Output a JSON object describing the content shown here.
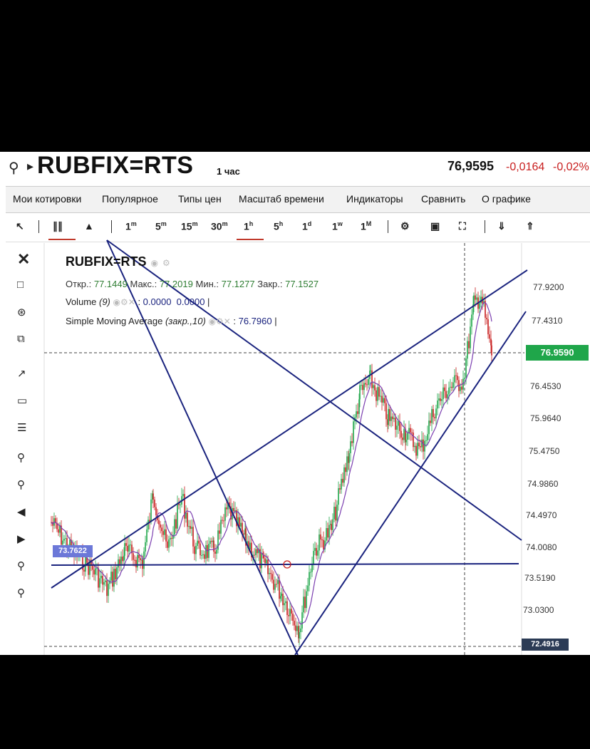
{
  "header": {
    "symbol": "RUBFIX=RTS",
    "interval": "1 час",
    "price": "76,9595",
    "change": "-0,0164",
    "change_pct": "-0,02%"
  },
  "menu": [
    "Мои котировки",
    "Популярное",
    "Типы цен",
    "Масштаб времени",
    "Индикаторы",
    "Сравнить",
    "О графике"
  ],
  "toolbar": {
    "timeframes": [
      "1m",
      "5m",
      "15m",
      "30m",
      "1h",
      "5h",
      "1d",
      "1w",
      "1M"
    ],
    "active_timeframe": "1h",
    "icons": [
      "cursor-icon",
      "candles-icon",
      "area-icon",
      "settings-icon",
      "camera-icon",
      "fullscreen-icon",
      "download-icon",
      "upload-icon"
    ]
  },
  "legend": {
    "title": "RUBFIX=RTS",
    "open_label": "Откр.:",
    "open": "77.1449",
    "high_label": "Макс.:",
    "high": "77.2019",
    "low_label": "Мин.:",
    "low": "77.1277",
    "close_label": "Закр.:",
    "close": "77.1527",
    "volume_label": "Volume",
    "volume_period": "(9)",
    "volume_value1": "0.0000",
    "volume_value2": "0.0000",
    "sma_label": "Simple Moving Average",
    "sma_params": "(закр.,10)",
    "sma_value": "76.7960"
  },
  "price_axis": [
    "77.9200",
    "77.4310",
    "76.4530",
    "75.9640",
    "75.4750",
    "74.9860",
    "74.4970",
    "74.0080",
    "73.5190",
    "73.0300"
  ],
  "badges": {
    "last_price": "76.9590",
    "period_low": "72.4916",
    "drawn_level": "73.7622"
  },
  "colors": {
    "up": "#1fa64a",
    "down": "#c81e1e",
    "drawing": "#1a237e",
    "sma": "#7b3fb0"
  }
}
